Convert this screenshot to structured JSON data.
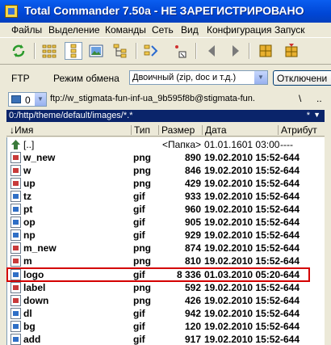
{
  "window": {
    "title": "Total Commander 7.50a - НЕ ЗАРЕГИСТРИРОВАНО"
  },
  "menu": [
    "Файлы",
    "Выделение",
    "Команды",
    "Сеть",
    "Вид",
    "Конфигурация",
    "Запуск"
  ],
  "toolbar_icons": [
    "refresh-icon",
    "brief-view-icon",
    "full-view-icon",
    "thumbnail-view-icon",
    "tree-view-icon",
    "sync-dirs-icon",
    "multi-rename-icon",
    "back-icon",
    "forward-icon",
    "pack-icon",
    "unpack-icon"
  ],
  "ftp_bar": {
    "label": "FTP",
    "mode_label": "Режим обмена",
    "mode_value": "Двоичный (zip, doc и т.д.)",
    "disconnect_label": "Отключени"
  },
  "drive_bar": {
    "drive": "0",
    "path": "ftp://w_stigmata-fun-inf-ua_9b595f8b@stigmata-fun.",
    "root_btn": "\\",
    "up_btn": ".."
  },
  "path_bar": {
    "path": "0:/http/theme/default/images/*.*",
    "filter": "*"
  },
  "columns": {
    "name": "↓Имя",
    "ext": "Тип",
    "size": "Размер",
    "date": "Дата",
    "attr": "Атрибут"
  },
  "files": [
    {
      "name": "[..]",
      "ext": "",
      "size": "<Папка>",
      "date": "01.01.1601 03:00",
      "attr": "----",
      "icon": "up"
    },
    {
      "name": "w_new",
      "ext": "png",
      "size": "890",
      "date": "19.02.2010 15:52",
      "attr": "-644",
      "icon": "png"
    },
    {
      "name": "w",
      "ext": "png",
      "size": "846",
      "date": "19.02.2010 15:52",
      "attr": "-644",
      "icon": "png"
    },
    {
      "name": "up",
      "ext": "png",
      "size": "429",
      "date": "19.02.2010 15:52",
      "attr": "-644",
      "icon": "png"
    },
    {
      "name": "tz",
      "ext": "gif",
      "size": "933",
      "date": "19.02.2010 15:52",
      "attr": "-644",
      "icon": "gif"
    },
    {
      "name": "pt",
      "ext": "gif",
      "size": "960",
      "date": "19.02.2010 15:52",
      "attr": "-644",
      "icon": "gif"
    },
    {
      "name": "op",
      "ext": "gif",
      "size": "905",
      "date": "19.02.2010 15:52",
      "attr": "-644",
      "icon": "gif"
    },
    {
      "name": "np",
      "ext": "gif",
      "size": "929",
      "date": "19.02.2010 15:52",
      "attr": "-644",
      "icon": "gif"
    },
    {
      "name": "m_new",
      "ext": "png",
      "size": "874",
      "date": "19.02.2010 15:52",
      "attr": "-644",
      "icon": "png"
    },
    {
      "name": "m",
      "ext": "png",
      "size": "810",
      "date": "19.02.2010 15:52",
      "attr": "-644",
      "icon": "png"
    },
    {
      "name": "logo",
      "ext": "gif",
      "size": "8 336",
      "date": "01.03.2010 05:20",
      "attr": "-644",
      "icon": "gif"
    },
    {
      "name": "label",
      "ext": "png",
      "size": "592",
      "date": "19.02.2010 15:52",
      "attr": "-644",
      "icon": "png"
    },
    {
      "name": "down",
      "ext": "png",
      "size": "426",
      "date": "19.02.2010 15:52",
      "attr": "-644",
      "icon": "png"
    },
    {
      "name": "dl",
      "ext": "gif",
      "size": "942",
      "date": "19.02.2010 15:52",
      "attr": "-644",
      "icon": "gif"
    },
    {
      "name": "bg",
      "ext": "gif",
      "size": "120",
      "date": "19.02.2010 15:52",
      "attr": "-644",
      "icon": "gif"
    },
    {
      "name": "add",
      "ext": "gif",
      "size": "917",
      "date": "19.02.2010 15:52",
      "attr": "-644",
      "icon": "gif"
    }
  ],
  "highlighted_file": "logo",
  "colors": {
    "title_bar": "#0046D5",
    "path_bar": "#0A246A",
    "highlight_box": "#D40000"
  }
}
